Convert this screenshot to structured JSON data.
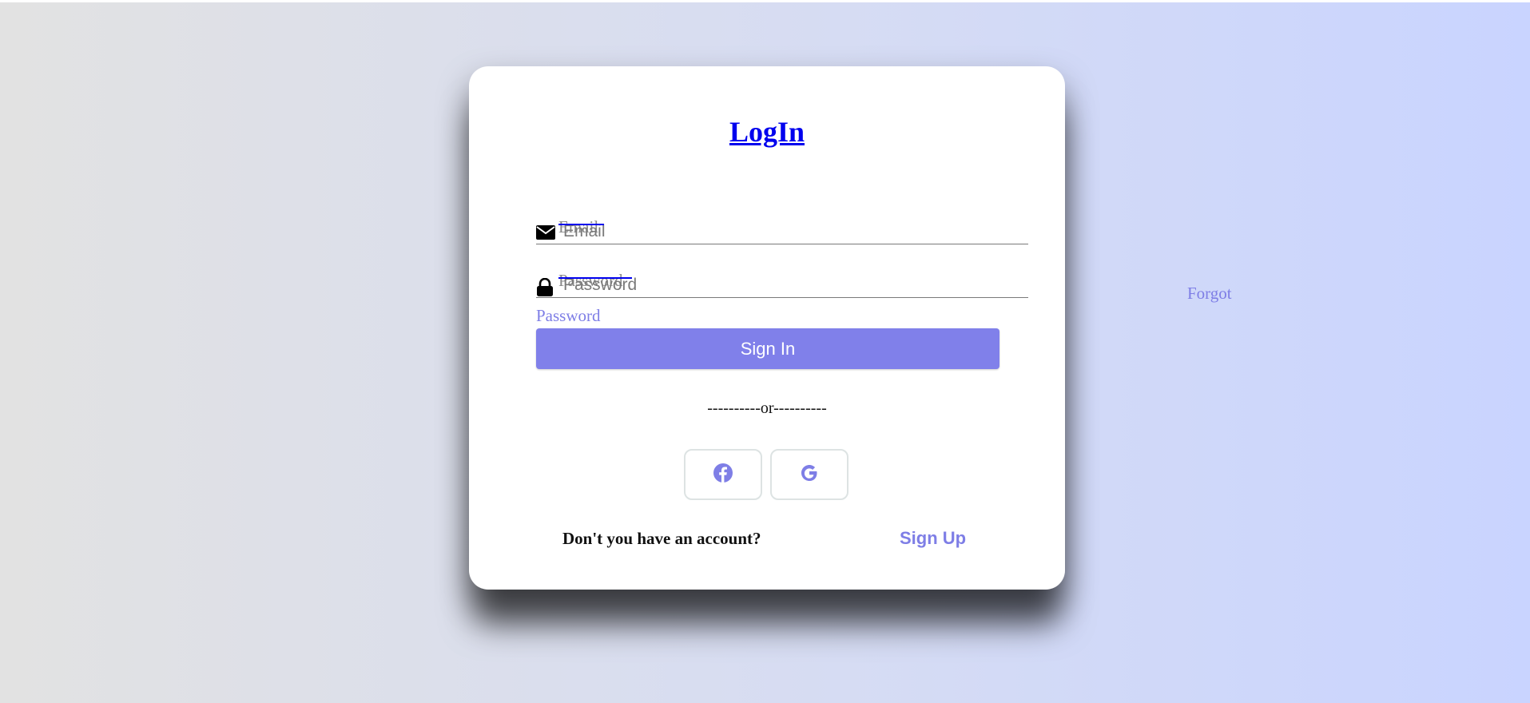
{
  "login": {
    "title": "LogIn",
    "email": {
      "label": "Email",
      "placeholder": "Email",
      "value": ""
    },
    "password": {
      "label": "Password",
      "placeholder": "Password",
      "value": ""
    },
    "forgot_password_word1": "Forgot",
    "forgot_password_word2": "Password",
    "signin_label": "Sign In",
    "divider": "----------or----------",
    "social": {
      "facebook_icon": "facebook-icon",
      "google_icon": "google-icon"
    },
    "account_prompt": "Don't you have an account?",
    "signup_label": "Sign Up"
  },
  "colors": {
    "accent": "#8080ea",
    "link_accent": "#7e7ee6",
    "title_link": "#0000ee",
    "background_start": "#e2e2e2",
    "background_end": "#c9d4ff"
  }
}
